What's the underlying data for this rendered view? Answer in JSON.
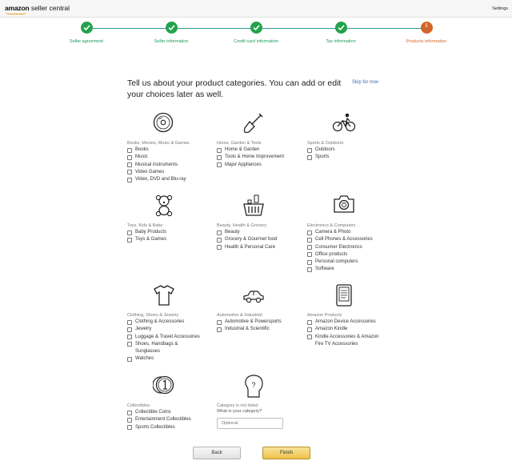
{
  "header": {
    "logo_brand": "amazon",
    "logo_product": "seller central",
    "settings_label": "Settings"
  },
  "steps": [
    {
      "label": "Seller agreement",
      "status": "done"
    },
    {
      "label": "Seller information",
      "status": "done"
    },
    {
      "label": "Credit card information",
      "status": "done"
    },
    {
      "label": "Tax information",
      "status": "done"
    },
    {
      "label": "Products information",
      "status": "current",
      "number": "5"
    }
  ],
  "intro": {
    "text": "Tell us about your product categories. You can add or edit your choices later as well.",
    "skip_label": "Skip for now"
  },
  "categories": [
    {
      "title": "Books, Movies, Music & Games",
      "icon": "disc-icon",
      "options": [
        "Books",
        "Music",
        "Musical instruments",
        "Video Games",
        "Video, DVD and Blu-ray"
      ]
    },
    {
      "title": "Home, Garden & Tools",
      "icon": "shovel-icon",
      "options": [
        "Home & Garden",
        "Tools & Home Improvement",
        "Major Appliances"
      ]
    },
    {
      "title": "Sports & Outdoors",
      "icon": "cyclist-icon",
      "options": [
        "Outdoors",
        "Sports"
      ]
    },
    {
      "title": "Toys, Kids & Baby",
      "icon": "teddy-bear-icon",
      "options": [
        "Baby Products",
        "Toys & Games"
      ]
    },
    {
      "title": "Beauty, Health & Grocery",
      "icon": "basket-icon",
      "options": [
        "Beauty",
        "Grocery & Gourmet food",
        "Health & Personal Care"
      ]
    },
    {
      "title": "Electronics & Computers",
      "icon": "camera-icon",
      "options": [
        "Camera & Photo",
        "Cell Phones & Accessories",
        "Consumer Electronics",
        "Office products",
        "Personal computers",
        "Software"
      ]
    },
    {
      "title": "Clothing, Shoes & Jewelry",
      "icon": "tshirt-icon",
      "options": [
        "Clothing & Accessories",
        "Jewelry",
        "Luggage & Travel Accessories",
        "Shoes, Handbags & Sunglasses",
        "Watches"
      ]
    },
    {
      "title": "Automotive & Industrial",
      "icon": "car-icon",
      "options": [
        "Automotive & Powersports",
        "Industrial & Scientific"
      ]
    },
    {
      "title": "Amazon Products",
      "icon": "kindle-icon",
      "options": [
        "Amazon Device Accessories",
        "Amazon Kindle",
        "Kindle Accessories & Amazon Fire TV Accessories"
      ]
    },
    {
      "title": "Collectibles",
      "icon": "coins-icon",
      "options": [
        "Collectible Coins",
        "Entertainment Collectibles",
        "Sports Collectibles"
      ]
    }
  ],
  "other": {
    "title": "Category is not listed",
    "question": "What is your category?",
    "placeholder": "Optional",
    "value": ""
  },
  "buttons": {
    "back_label": "Back",
    "finish_label": "Finish"
  },
  "colors": {
    "step_done": "#23a24d",
    "step_current": "#d1652a",
    "finish_button": "#efc24b",
    "link": "#3a6ea8"
  }
}
